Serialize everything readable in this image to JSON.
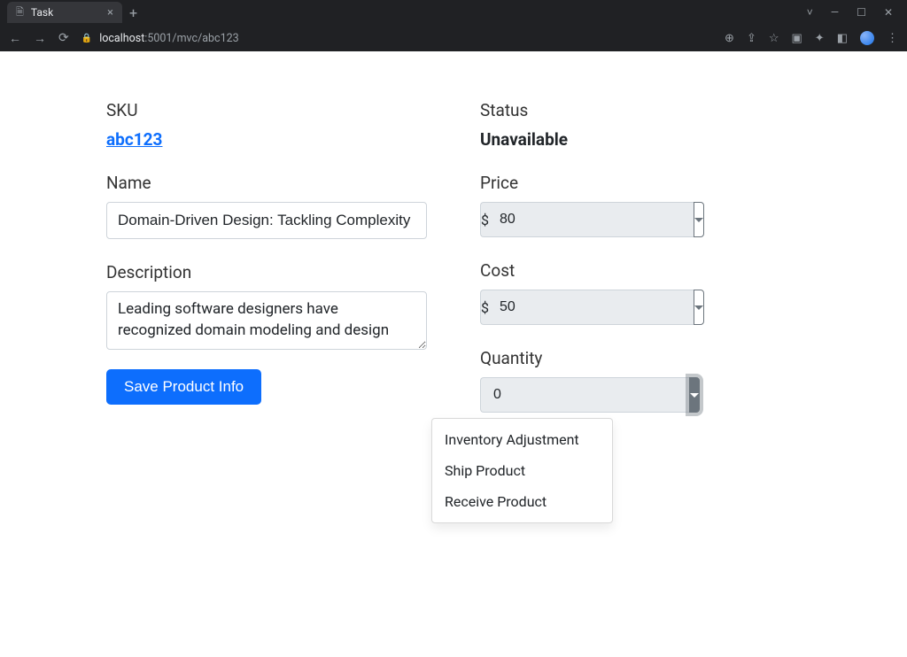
{
  "browser": {
    "tab_title": "Task",
    "url_host": "localhost",
    "url_path": ":5001/mvc/abc123"
  },
  "left": {
    "sku_label": "SKU",
    "sku_value": "abc123",
    "name_label": "Name",
    "name_value": "Domain-Driven Design: Tackling Complexity",
    "description_label": "Description",
    "description_value": "Leading software designers have recognized domain modeling and design",
    "save_label": "Save Product Info"
  },
  "right": {
    "status_label": "Status",
    "status_value": "Unavailable",
    "price_label": "Price",
    "price_currency": "$",
    "price_value": "80",
    "cost_label": "Cost",
    "cost_currency": "$",
    "cost_value": "50",
    "quantity_label": "Quantity",
    "quantity_value": "0",
    "quantity_menu": {
      "inventory_adjustment": "Inventory Adjustment",
      "ship_product": "Ship Product",
      "receive_product": "Receive Product"
    }
  }
}
